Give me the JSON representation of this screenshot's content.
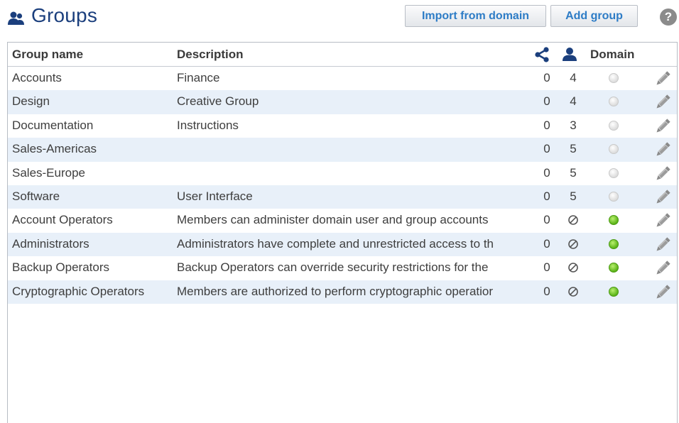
{
  "header": {
    "title": "Groups",
    "title_icon": "group-icon",
    "import_label": "Import from domain",
    "add_label": "Add group",
    "help_label": "?"
  },
  "table": {
    "columns": {
      "name": "Group name",
      "description": "Description",
      "shares_icon": "share-icon",
      "members_icon": "user-icon",
      "domain": "Domain"
    },
    "rows": [
      {
        "name": "Accounts",
        "description": "Finance",
        "shares": "0",
        "members": "4",
        "domain": false
      },
      {
        "name": "Design",
        "description": "Creative Group",
        "shares": "0",
        "members": "4",
        "domain": false
      },
      {
        "name": "Documentation",
        "description": "Instructions",
        "shares": "0",
        "members": "3",
        "domain": false
      },
      {
        "name": "Sales-Americas",
        "description": "",
        "shares": "0",
        "members": "5",
        "domain": false
      },
      {
        "name": "Sales-Europe",
        "description": "",
        "shares": "0",
        "members": "5",
        "domain": false
      },
      {
        "name": "Software",
        "description": "User Interface",
        "shares": "0",
        "members": "5",
        "domain": false
      },
      {
        "name": "Account Operators",
        "description": "Members can administer domain user and group accounts",
        "shares": "0",
        "members": "none-icon",
        "domain": true
      },
      {
        "name": "Administrators",
        "description": "Administrators have complete and unrestricted access to th",
        "shares": "0",
        "members": "none-icon",
        "domain": true
      },
      {
        "name": "Backup Operators",
        "description": "Backup Operators can override security restrictions for the",
        "shares": "0",
        "members": "none-icon",
        "domain": true
      },
      {
        "name": "Cryptographic Operators",
        "description": "Members are authorized to perform cryptographic operatior",
        "shares": "0",
        "members": "none-icon",
        "domain": true
      }
    ]
  },
  "colors": {
    "title": "#1b3f7d",
    "button_text": "#2d7cc6",
    "row_alt": "#e8f0f9",
    "domain_on": "#5ab318",
    "domain_off": "#dcdcdc"
  }
}
